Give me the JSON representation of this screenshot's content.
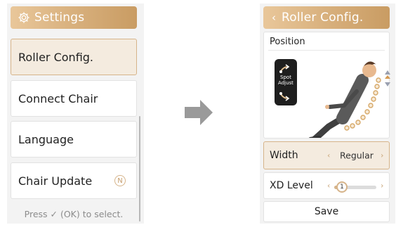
{
  "left_screen": {
    "header": {
      "title": "Settings",
      "icon": "gear-icon"
    },
    "menu_items": [
      {
        "label": "Roller Config.",
        "selected": true
      },
      {
        "label": "Connect Chair",
        "selected": false
      },
      {
        "label": "Language",
        "selected": false
      },
      {
        "label": "Chair Update",
        "selected": false,
        "badge": "N"
      }
    ],
    "hint": "Press ✓ (OK) to select."
  },
  "right_screen": {
    "header": {
      "title": "Roller Config.",
      "back_icon": "chevron-left-icon"
    },
    "position": {
      "label": "Position",
      "spot_adjust_label_line1": "Spot",
      "spot_adjust_label_line2": "Adjust"
    },
    "width": {
      "label": "Width",
      "value": "Regular"
    },
    "xd_level": {
      "label": "XD Level",
      "value": "1",
      "level_fraction": 0.1
    },
    "save_label": "Save"
  },
  "colors": {
    "accent_light": "#e9c79a",
    "accent_dark": "#c99c63",
    "selected_bg": "#f4ebdf",
    "arrow": "#9a9a9a"
  }
}
